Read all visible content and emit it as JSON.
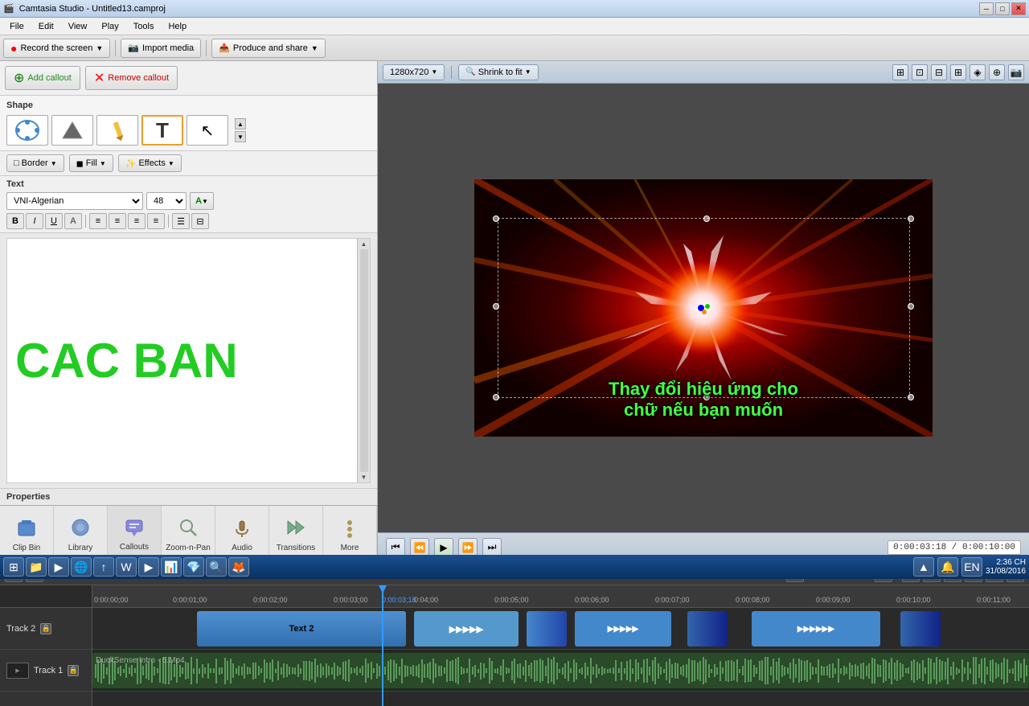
{
  "window": {
    "title": "Camtasia Studio - Untitled13.camproj",
    "icon": "🎬"
  },
  "menu": {
    "items": [
      "File",
      "Edit",
      "View",
      "Play",
      "Tools",
      "Help"
    ]
  },
  "toolbar": {
    "record_label": "Record the screen",
    "import_label": "Import media",
    "produce_label": "Produce and share"
  },
  "left_panel": {
    "add_callout_label": "Add callout",
    "remove_callout_label": "Remove callout",
    "shape_label": "Shape",
    "border_label": "Border",
    "fill_label": "Fill",
    "effects_label": "Effects",
    "text_label": "Text",
    "font_name": "VNI-Algerian",
    "font_size": "48",
    "preview_text": "CAC BAN",
    "properties_label": "Properties"
  },
  "tabs": [
    {
      "id": "clip-bin",
      "label": "Clip Bin",
      "icon": "📁"
    },
    {
      "id": "library",
      "label": "Library",
      "icon": "📚"
    },
    {
      "id": "callouts",
      "label": "Callouts",
      "icon": "💬"
    },
    {
      "id": "zoom-n-pan",
      "label": "Zoom-n-Pan",
      "icon": "🔍"
    },
    {
      "id": "audio",
      "label": "Audio",
      "icon": "🎵"
    },
    {
      "id": "transitions",
      "label": "Transitions",
      "icon": "↔"
    },
    {
      "id": "more",
      "label": "More",
      "icon": "⋯"
    }
  ],
  "preview": {
    "resolution": "1280x720",
    "fit_label": "Shrink to fit"
  },
  "playback": {
    "time_current": "0:00:03:18",
    "time_total": "0:00:10:00"
  },
  "timeline": {
    "tracks": [
      {
        "id": "track2",
        "label": "Track 2",
        "clip_label": "Text 2"
      },
      {
        "id": "track1",
        "label": "Track 1",
        "clip_label": "DuckSense Intro - 5.Mp4"
      }
    ],
    "ruler_marks": [
      "0:00:00;00",
      "0:00:01;00",
      "0:00:02;00",
      "0:00:03;00",
      "0:04;00",
      "0:00:05;00",
      "0:00:06;00",
      "0:00:07;00",
      "0:00:08;00",
      "0:00:09;00",
      "0:00:10;00",
      "0:00:11;00"
    ]
  },
  "subtitle": {
    "line1": "Thay đổi hiệu ứng cho",
    "line2": "chữ nếu bạn muốn"
  },
  "taskbar": {
    "time": "2:36 CH",
    "date": "31/08/2016"
  }
}
